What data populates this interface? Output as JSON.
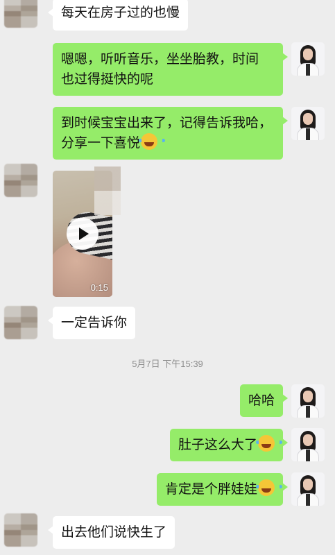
{
  "messages": [
    {
      "text": "每天在房子过的也慢"
    },
    {
      "text_line1": "嗯嗯，听听音乐，坐坐胎教，时间",
      "text_line2": "也过得挺快的呢"
    },
    {
      "text_line1": "到时候宝宝出来了，记得告诉我哈，",
      "text_line2": "分享一下喜悦",
      "emoji": "laugh-cry-emoji"
    },
    {
      "video_duration": "0:15"
    },
    {
      "text": "一定告诉你"
    },
    {
      "text": "哈哈"
    },
    {
      "text": "肚子这么大了",
      "emoji": "laugh-cry-emoji"
    },
    {
      "text": "肯定是个胖娃娃",
      "emoji": "laugh-cry-emoji"
    },
    {
      "text": "出去他们说快生了"
    }
  ],
  "timestamp": "5月7日 下午15:39",
  "colors": {
    "self_bubble": "#95ec69",
    "other_bubble": "#ffffff",
    "background": "#ededed"
  }
}
